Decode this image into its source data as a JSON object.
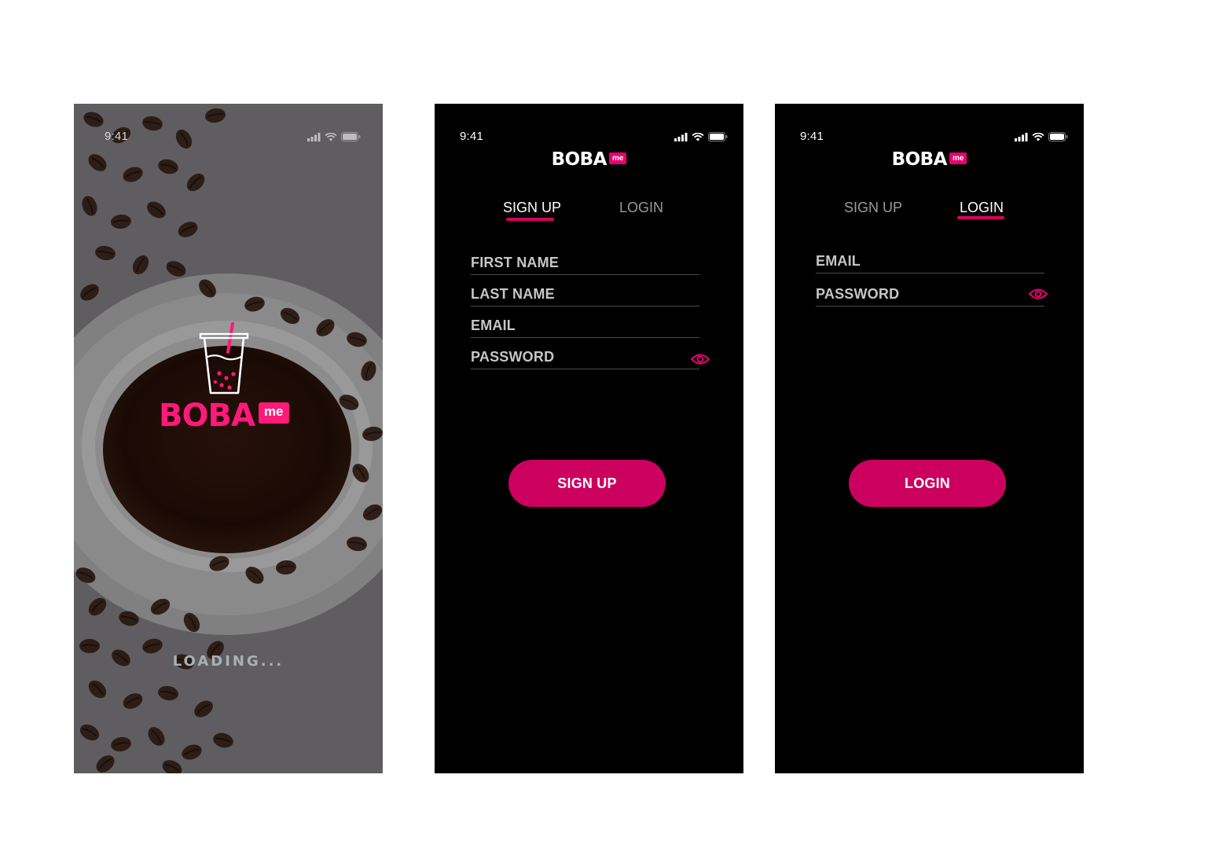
{
  "colors": {
    "accent": "#e8006f",
    "button": "#cc005e",
    "screen_bg": "#000000",
    "splash_overlay": "#5f5d5f"
  },
  "status_bar": {
    "time": "9:41"
  },
  "brand": {
    "word": "BOBA",
    "badge": "me"
  },
  "splash": {
    "loading_text": "LOADING..."
  },
  "signup_screen": {
    "tabs": [
      {
        "label": "SIGN UP",
        "active": true
      },
      {
        "label": "LOGIN",
        "active": false
      }
    ],
    "fields": [
      {
        "label": "FIRST NAME"
      },
      {
        "label": "LAST NAME"
      },
      {
        "label": "EMAIL"
      },
      {
        "label": "PASSWORD",
        "icon": "eye-icon"
      }
    ],
    "button": "SIGN UP"
  },
  "login_screen": {
    "tabs": [
      {
        "label": "SIGN UP",
        "active": false
      },
      {
        "label": "LOGIN",
        "active": true
      }
    ],
    "fields": [
      {
        "label": "EMAIL"
      },
      {
        "label": "PASSWORD",
        "icon": "eye-icon"
      }
    ],
    "button": "LOGIN"
  }
}
